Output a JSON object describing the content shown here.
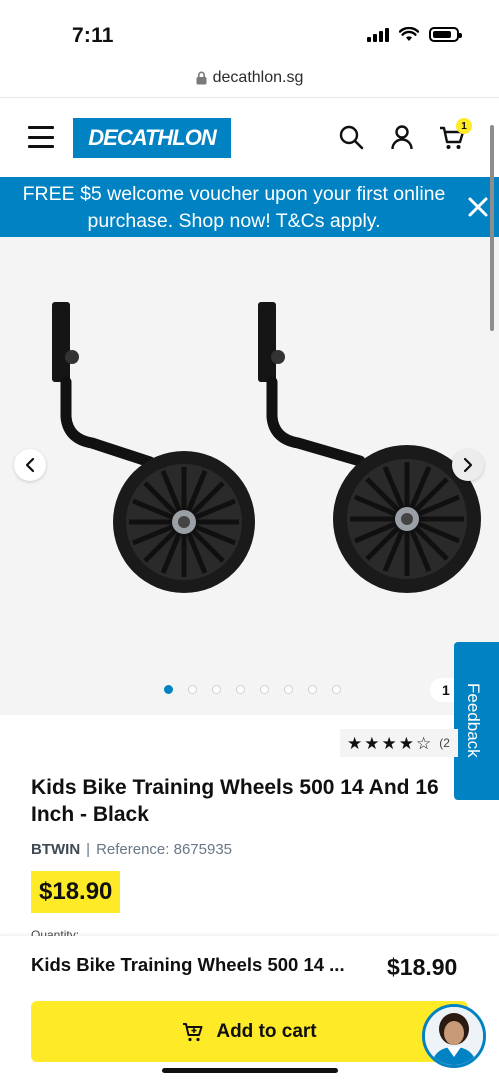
{
  "status_bar": {
    "time": "7:11",
    "battery_level": 0.8
  },
  "browser": {
    "url": "decathlon.sg",
    "lock_icon": "lock-icon"
  },
  "header": {
    "logo_text": "DECATHLON",
    "brand_color": "#0082c3",
    "menu_icon": "hamburger-icon",
    "search_icon": "search-icon",
    "account_icon": "user-icon",
    "cart_icon": "cart-icon",
    "cart_count": "1"
  },
  "promo_banner": {
    "text": "FREE $5 welcome voucher upon your first online purchase. Shop now! T&Cs apply.",
    "close_icon": "close-icon"
  },
  "gallery": {
    "background": "#f5f4f5",
    "image_alt": "Kids bike training wheels",
    "prev_icon": "chevron-left-icon",
    "next_icon": "chevron-right-icon",
    "dot_count": 8,
    "active_dot": 0,
    "image_counter": "1"
  },
  "feedback_tab": {
    "label": "Feedback"
  },
  "product": {
    "rating_value": 4,
    "rating_max": 5,
    "rating_count": "(2",
    "title": "Kids Bike Training Wheels 500 14 And 16 Inch - Black",
    "brand": "BTWIN",
    "separator": "|",
    "reference": "Reference: 8675935",
    "price": "$18.90",
    "quantity_label": "Quantity:"
  },
  "sticky_bar": {
    "product_name": "Kids Bike Training Wheels 500 14 ...",
    "price": "$18.90",
    "add_to_cart_label": "Add to cart",
    "accent_color": "#ffea28",
    "chat_icon": "chat-assistant-avatar"
  }
}
